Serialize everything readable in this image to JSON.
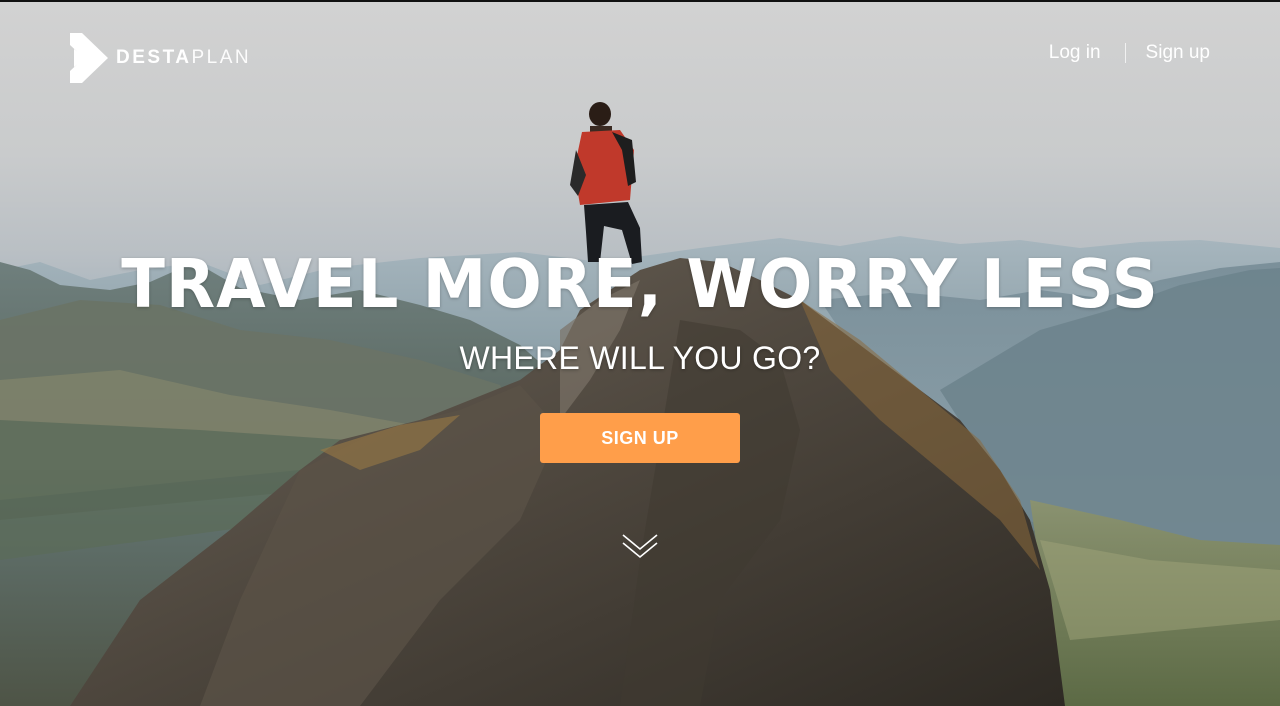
{
  "brand": {
    "name_bold": "DESTA",
    "name_light": "PLAN",
    "logo_icon": "destaplan-logo-icon"
  },
  "nav": {
    "login_label": "Log in",
    "signup_label": "Sign up"
  },
  "hero": {
    "headline": "TRAVEL MORE, WORRY LESS",
    "subheadline": "WHERE WILL YOU GO?",
    "cta_label": "SIGN UP",
    "scroll_icon": "chevron-double-down-icon",
    "background_image": "hiker-on-mountain-summit"
  },
  "colors": {
    "accent": "#ff9e4a",
    "text": "#ffffff"
  }
}
